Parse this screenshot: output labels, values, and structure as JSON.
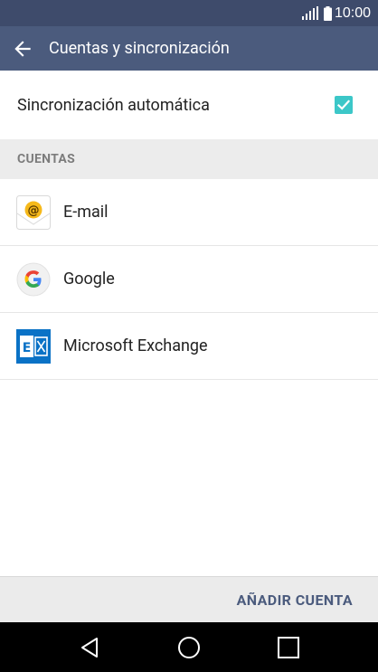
{
  "status_bar": {
    "time": "10:00",
    "icons": [
      "signal-icon",
      "battery-icon"
    ]
  },
  "app_bar": {
    "back_icon": "arrow-left-icon",
    "title": "Cuentas y sincronización"
  },
  "sync": {
    "label": "Sincronización automática",
    "checked": true
  },
  "section": {
    "header": "CUENTAS"
  },
  "accounts": [
    {
      "name": "E-mail",
      "icon": "email-app-icon"
    },
    {
      "name": "Google",
      "icon": "google-icon"
    },
    {
      "name": "Microsoft Exchange",
      "icon": "exchange-icon"
    }
  ],
  "footer": {
    "add_account_label": "AÑADIR CUENTA"
  },
  "nav": {
    "icons": [
      "back-triangle-icon",
      "home-circle-icon",
      "recents-square-icon"
    ]
  },
  "colors": {
    "status_bar": "#3e4b6b",
    "app_bar": "#4b5b7d",
    "checkbox": "#3cc7c8",
    "accent_text": "#4b5b7d"
  }
}
